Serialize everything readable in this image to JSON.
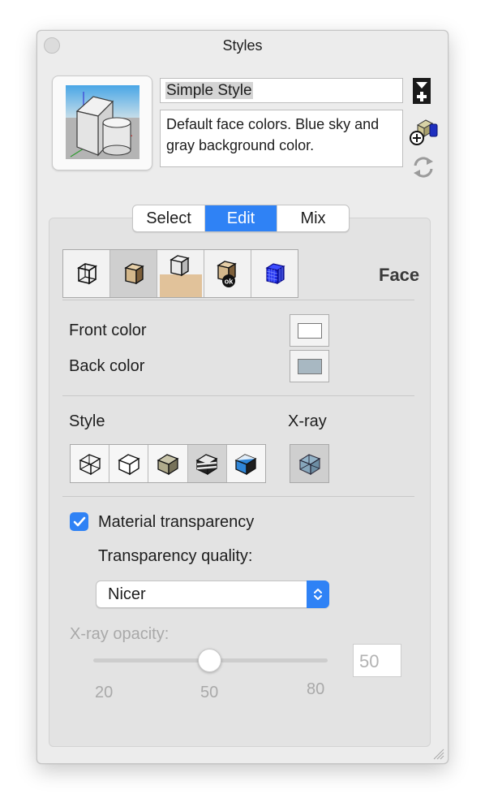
{
  "window": {
    "title": "Styles"
  },
  "style": {
    "name": "Simple Style",
    "description": "Default face colors. Blue sky and gray background color."
  },
  "segmented": {
    "tabs": [
      "Select",
      "Edit",
      "Mix"
    ],
    "active": "Edit"
  },
  "settings_tabs": {
    "icons": [
      "edge-settings-icon",
      "face-settings-icon",
      "background-settings-icon",
      "watermark-settings-icon",
      "modeling-settings-icon"
    ],
    "selected": "face-settings-icon",
    "section_title": "Face"
  },
  "face": {
    "front_color_label": "Front color",
    "back_color_label": "Back color",
    "front_color": "#ffffff",
    "back_color": "#a8b8c2"
  },
  "style_section": {
    "style_label": "Style",
    "xray_label": "X-ray",
    "selected_style": "shaded-with-textures"
  },
  "transparency": {
    "checkbox_label": "Material transparency",
    "checked": true,
    "quality_label": "Transparency quality:",
    "quality_value": "Nicer"
  },
  "xray_opacity": {
    "label": "X-ray opacity:",
    "value": "50",
    "ticks": [
      "20",
      "50",
      "80"
    ]
  },
  "colors": {
    "accent": "#2f82f5",
    "panel": "#e3e3e3",
    "window": "#ececec"
  }
}
